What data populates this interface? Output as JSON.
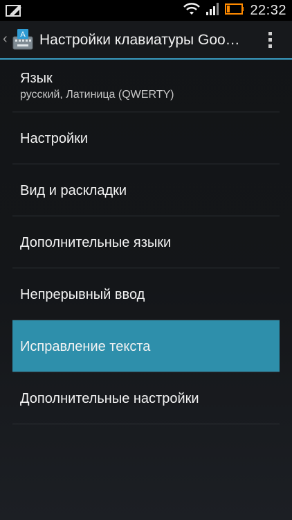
{
  "status_bar": {
    "time": "22:32",
    "left_icon": "edit-icon",
    "right_icons": [
      "wifi-icon",
      "signal-icon",
      "battery-icon"
    ],
    "battery_color": "#ff8a00"
  },
  "action_bar": {
    "up_icon": "chevron-left-icon",
    "app_icon": "keyboard-app-icon",
    "title": "Настройки клавиатуры Goo…",
    "overflow_icon": "overflow-menu-icon",
    "accent_color": "#3a9ec4"
  },
  "settings": {
    "items": [
      {
        "title": "Язык",
        "summary": "русский, Латиница (QWERTY)"
      },
      {
        "title": "Настройки"
      },
      {
        "title": "Вид и раскладки"
      },
      {
        "title": "Дополнительные языки"
      },
      {
        "title": "Непрерывный ввод"
      },
      {
        "title": "Исправление текста",
        "selected": true
      },
      {
        "title": "Дополнительные настройки"
      }
    ],
    "selected_color": "#2e8fab"
  }
}
